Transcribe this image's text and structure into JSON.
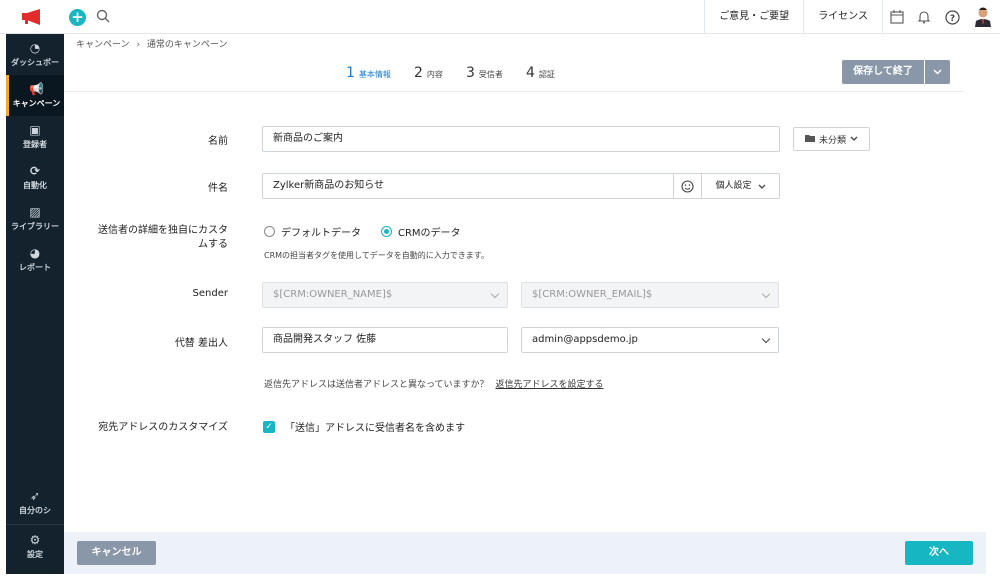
{
  "topbar": {
    "feedback": "ご意見・ご要望",
    "license": "ライセンス"
  },
  "sidebar": {
    "items": [
      {
        "label": "ダッシュボー",
        "icon": "dashboard-icon"
      },
      {
        "label": "キャンペーン",
        "icon": "megaphone-icon"
      },
      {
        "label": "登録者",
        "icon": "contact-card-icon"
      },
      {
        "label": "自動化",
        "icon": "automation-icon"
      },
      {
        "label": "ライブラリー",
        "icon": "image-icon"
      },
      {
        "label": "レポート",
        "icon": "pie-chart-icon"
      }
    ],
    "bottom": [
      {
        "label": "自分のシ",
        "icon": "rocket-icon"
      },
      {
        "label": "設定",
        "icon": "gear-icon"
      }
    ]
  },
  "breadcrumb": {
    "root": "キャンペーン",
    "sep": "›",
    "current": "通常のキャンペーン"
  },
  "steps": [
    {
      "num": "1",
      "label": "基本情報"
    },
    {
      "num": "2",
      "label": "内容"
    },
    {
      "num": "3",
      "label": "受信者"
    },
    {
      "num": "4",
      "label": "認証"
    }
  ],
  "save_button": "保存して終了",
  "form": {
    "name_label": "名前",
    "name_value": "新商品のご案内",
    "folder_label": "未分類",
    "subject_label": "件名",
    "subject_value": "Zylker新商品のお知らせ",
    "personalize_label": "個人設定",
    "sender_custom_label_1": "送信者の詳細を独自にカスタ",
    "sender_custom_label_2": "ムする",
    "radio_default": "デフォルトデータ",
    "radio_crm": "CRMのデータ",
    "crm_hint": "CRMの担当者タグを使用してデータを自動的に入力できます。",
    "sender_label": "Sender",
    "sender_name": "$[CRM:OWNER_NAME]$",
    "sender_email": "$[CRM:OWNER_EMAIL]$",
    "alt_sender_label": "代替 差出人",
    "alt_sender_name": "商品開発スタッフ 佐藤",
    "alt_sender_email": "admin@appsdemo.jp",
    "reply_question": "返信先アドレスは送信者アドレスと異なっていますか？",
    "reply_link": "返信先アドレスを設定する",
    "to_custom_label": "宛先アドレスのカスタマイズ",
    "to_custom_check": "「送信」アドレスに受信者名を含めます"
  },
  "footer": {
    "cancel": "キャンセル",
    "next": "次へ"
  },
  "colors": {
    "accent": "#16b6c2",
    "sidebar": "#14222e",
    "active_step": "#1a7bd6",
    "gray_button": "#8a97a8"
  }
}
